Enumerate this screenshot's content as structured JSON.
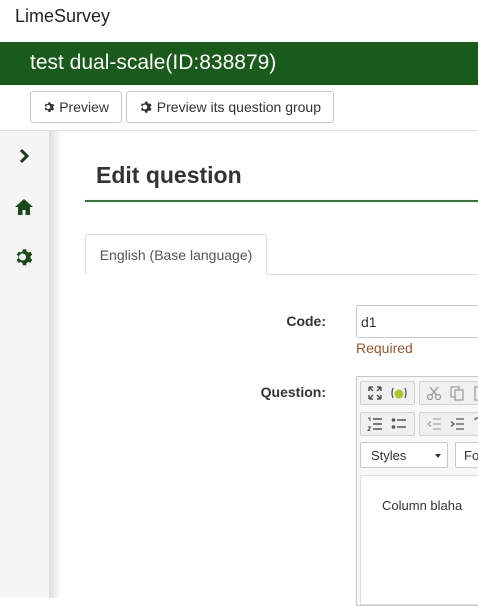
{
  "app": {
    "brand": "LimeSurvey"
  },
  "survey": {
    "title": "test dual-scale(ID:838879)"
  },
  "toolbar": {
    "preview_label": "Preview",
    "preview_group_label": "Preview its question group"
  },
  "sidebar": {
    "icons": [
      "chevron-right-icon",
      "home-icon",
      "gear-icon"
    ]
  },
  "page": {
    "title": "Edit question"
  },
  "tabs": [
    {
      "label": "English (Base language)"
    }
  ],
  "form": {
    "code": {
      "label": "Code:",
      "value": "d1",
      "hint": "Required"
    },
    "question": {
      "label": "Question:",
      "styles_label": "Styles",
      "format_label": "Fo",
      "content": "Column blaha"
    }
  },
  "colors": {
    "header_green": "#1a5a1a",
    "accent_green": "#2c7a2c",
    "required": "#a0522d"
  }
}
